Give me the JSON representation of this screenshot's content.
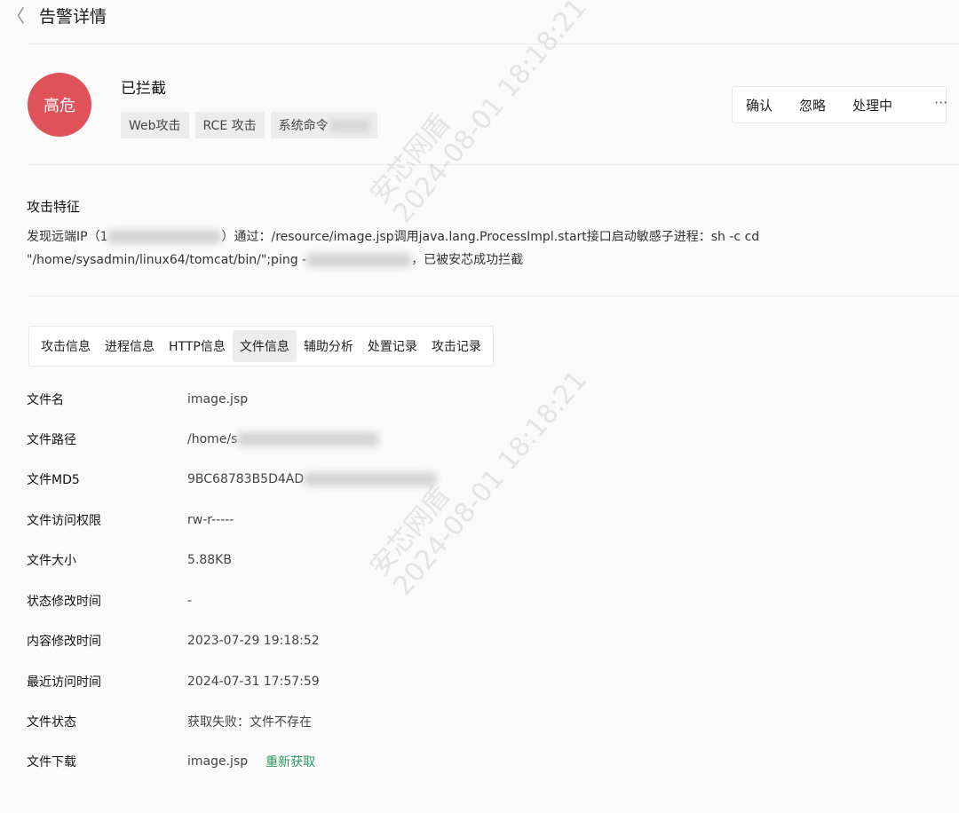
{
  "header": {
    "back_glyph": "〈",
    "title": "告警详情"
  },
  "alert": {
    "risk_level": "高危",
    "status": "已拦截",
    "tags": [
      "Web攻击",
      "RCE 攻击",
      "系统命令"
    ],
    "risk_color": "#e0525a"
  },
  "actions": {
    "confirm": "确认",
    "ignore": "忽略",
    "handle": "处理中",
    "more": "···"
  },
  "features": {
    "title": "攻击特征",
    "line1_prefix": "发现远端IP（1",
    "line1_middle": "）通过：/resource/image.jsp调用java.lang.ProcessImpl.start接口启动敏感子进程：sh -c cd",
    "line2_prefix": "\"/home/sysadmin/linux64/tomcat/bin/\";ping -",
    "line2_suffix": "，已被安芯成功拦截"
  },
  "tabs": [
    "攻击信息",
    "进程信息",
    "HTTP信息",
    "文件信息",
    "辅助分析",
    "处置记录",
    "攻击记录"
  ],
  "active_tab": "文件信息",
  "file_info": [
    {
      "label": "文件名",
      "value": "image.jsp"
    },
    {
      "label": "文件路径",
      "value": "/home/s"
    },
    {
      "label": "文件MD5",
      "value": "9BC68783B5D4AD"
    },
    {
      "label": "文件访问权限",
      "value": "rw-r-----"
    },
    {
      "label": "文件大小",
      "value": "5.88KB"
    },
    {
      "label": "状态修改时间",
      "value": "-"
    },
    {
      "label": "内容修改时间",
      "value": "2023-07-29 19:18:52"
    },
    {
      "label": "最近访问时间",
      "value": "2024-07-31 17:57:59"
    },
    {
      "label": "文件状态",
      "value": "获取失败：文件不存在"
    },
    {
      "label": "文件下载",
      "value": "image.jsp",
      "link": "重新获取"
    }
  ],
  "watermark": {
    "brand": "安芯网盾",
    "timestamp": "2024-08-01 18:18:21"
  },
  "colors": {
    "link_green": "#2f9a5f",
    "background": "#fafafa"
  }
}
